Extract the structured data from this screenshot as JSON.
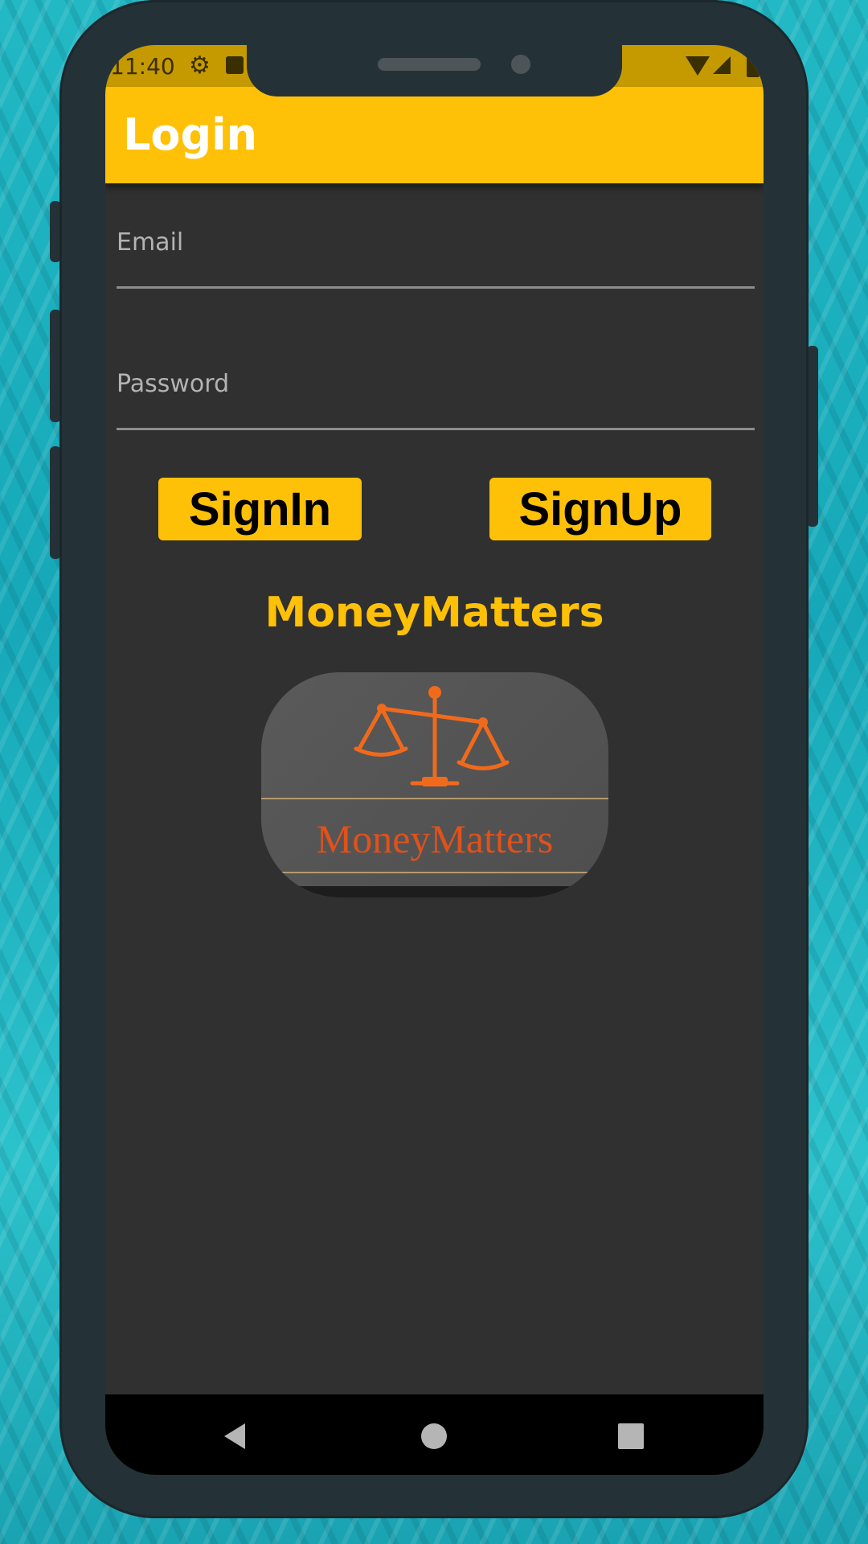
{
  "status_bar": {
    "time": "11:40"
  },
  "app_bar": {
    "title": "Login"
  },
  "form": {
    "email": {
      "placeholder": "Email",
      "value": ""
    },
    "password": {
      "placeholder": "Password",
      "value": ""
    }
  },
  "buttons": {
    "sign_in": "SignIn",
    "sign_up": "SignUp"
  },
  "brand": {
    "heading": "MoneyMatters",
    "logo_text": "MoneyMatters"
  },
  "colors": {
    "accent": "#ffc107",
    "background": "#303030",
    "logo_orange": "#e0511b",
    "phone_frame": "#243238"
  },
  "icons": {
    "status": [
      "gear-icon",
      "lock-icon",
      "wifi-icon",
      "signal-icon",
      "battery-icon"
    ],
    "navigation": [
      "back-icon",
      "home-icon",
      "recents-icon"
    ],
    "logo": "scales-icon"
  }
}
